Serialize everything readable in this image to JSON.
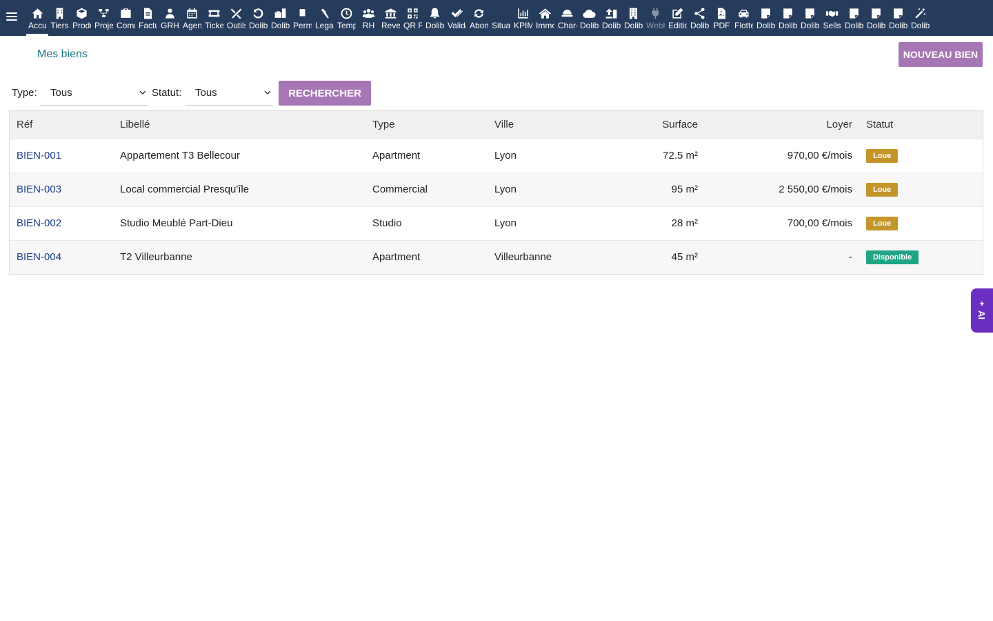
{
  "nav": {
    "items": [
      {
        "label": "Accueil",
        "icon": "home-icon",
        "active": true
      },
      {
        "label": "Tiers",
        "icon": "building-icon"
      },
      {
        "label": "Produits",
        "icon": "cube-icon"
      },
      {
        "label": "Projets",
        "icon": "project-icon"
      },
      {
        "label": "Commercial",
        "icon": "suitcase-icon"
      },
      {
        "label": "Facturation",
        "icon": "invoice-icon"
      },
      {
        "label": "GRH",
        "icon": "user-icon"
      },
      {
        "label": "Agenda",
        "icon": "calendar-icon"
      },
      {
        "label": "Tickets",
        "icon": "ticket-icon"
      },
      {
        "label": "Outils",
        "icon": "tools-icon"
      },
      {
        "label": "Dolibarr",
        "icon": "undo-icon"
      },
      {
        "label": "Dolibarr",
        "icon": "briefcase-icon"
      },
      {
        "label": "Permissions",
        "icon": "pin-icon"
      },
      {
        "label": "Legal",
        "icon": "gavel-icon"
      },
      {
        "label": "Temps",
        "icon": "clock-icon"
      },
      {
        "label": "RH",
        "icon": "users-icon"
      },
      {
        "label": "Revenus",
        "icon": "bank-icon"
      },
      {
        "label": "QR Payment",
        "icon": "qrcode-icon"
      },
      {
        "label": "Dolibarr",
        "icon": "bell-icon"
      },
      {
        "label": "Validation",
        "icon": "check-double-icon"
      },
      {
        "label": "Abonnements",
        "icon": "sync-icon"
      },
      {
        "label": "Situations",
        "icon": "blank-icon"
      },
      {
        "label": "KPIM",
        "icon": "chart-bar-icon"
      },
      {
        "label": "Immobilier",
        "icon": "house-icon"
      },
      {
        "label": "Charges",
        "icon": "bowl-icon"
      },
      {
        "label": "Dolibarr",
        "icon": "cloud-icon"
      },
      {
        "label": "Dolibarr",
        "icon": "upload-icon"
      },
      {
        "label": "Dolibarr",
        "icon": "office-icon"
      },
      {
        "label": "Webhooks",
        "icon": "plug-icon",
        "disabled": true
      },
      {
        "label": "Edition",
        "icon": "edit-icon"
      },
      {
        "label": "Dolibarr",
        "icon": "share-icon"
      },
      {
        "label": "PDF",
        "icon": "pdf-icon"
      },
      {
        "label": "Flotte",
        "icon": "car-icon"
      },
      {
        "label": "Dolibarr",
        "icon": "note-icon"
      },
      {
        "label": "Dolibarr",
        "icon": "note-icon"
      },
      {
        "label": "Dolibarr",
        "icon": "note-icon"
      },
      {
        "label": "Sells",
        "icon": "handshake-icon"
      },
      {
        "label": "Dolibarr",
        "icon": "note-icon"
      },
      {
        "label": "Dolibarr",
        "icon": "note-icon"
      },
      {
        "label": "Dolibarr",
        "icon": "note-icon"
      },
      {
        "label": "Dolibarr",
        "icon": "magic-wand-icon"
      }
    ]
  },
  "page": {
    "title": "Mes biens",
    "new_button": "NOUVEAU BIEN"
  },
  "filters": {
    "type_label": "Type:",
    "type_value": "Tous",
    "status_label": "Statut:",
    "status_value": "Tous",
    "search_button": "RECHERCHER"
  },
  "table": {
    "columns": [
      "Réf",
      "Libellé",
      "Type",
      "Ville",
      "Surface",
      "Loyer",
      "Statut"
    ],
    "rows": [
      {
        "ref": "BIEN-001",
        "label": "Appartement T3 Bellecour",
        "type": "Apartment",
        "city": "Lyon",
        "surface": "72.5 m²",
        "rent": "970,00 €/mois",
        "status": "Loue",
        "status_color": "#c4962a"
      },
      {
        "ref": "BIEN-003",
        "label": "Local commercial Presqu'île",
        "type": "Commercial",
        "city": "Lyon",
        "surface": "95 m²",
        "rent": "2 550,00 €/mois",
        "status": "Loue",
        "status_color": "#c4962a"
      },
      {
        "ref": "BIEN-002",
        "label": "Studio Meublé Part-Dieu",
        "type": "Studio",
        "city": "Lyon",
        "surface": "28 m²",
        "rent": "700,00 €/mois",
        "status": "Loue",
        "status_color": "#c4962a"
      },
      {
        "ref": "BIEN-004",
        "label": "T2 Villeurbanne",
        "type": "Apartment",
        "city": "Villeurbanne",
        "surface": "45 m²",
        "rent": "-",
        "status": "Disponible",
        "status_color": "#1fa583"
      }
    ]
  },
  "ai_tab": {
    "label": "AI"
  },
  "colors": {
    "nav_bg": "#263c5c",
    "accent": "#a777b5",
    "title": "#1d7983",
    "link": "#1e3f8f"
  }
}
